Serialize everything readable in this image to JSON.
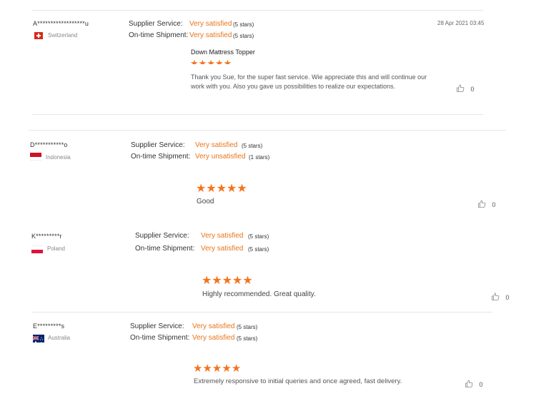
{
  "reviews": [
    {
      "buyer": "A******************u",
      "country": "Switzerland",
      "flag": "switzerland-flag",
      "supplier_label": "Supplier Service:",
      "supplier_value": "Very satisfied",
      "supplier_stars": "(5 stars)",
      "shipment_label": "On-time Shipment:",
      "shipment_value": "Very satisfied",
      "shipment_stars": "(5 stars)",
      "date": "28 Apr 2021 03:45",
      "product": "Down Mattress Topper",
      "rating": 5,
      "comment": "Thank you Sue, for the super fast service. Wie appreciate this and will continue our work with you. Also you gave us possibilities to realize our expectations.",
      "likes": "0"
    },
    {
      "buyer": "D***********o",
      "country": "Indonesia",
      "flag": "indonesia-flag",
      "supplier_label": "Supplier Service:",
      "supplier_value": "Very satisfied",
      "supplier_stars": "(5 stars)",
      "shipment_label": "On-time Shipment:",
      "shipment_value": "Very unsatisfied",
      "shipment_stars": "(1 stars)",
      "rating": 5,
      "comment": "Good",
      "likes": "0"
    },
    {
      "buyer": "K*********r",
      "country": "Poland",
      "flag": "poland-flag",
      "supplier_label": "Supplier Service:",
      "supplier_value": "Very satisfied",
      "supplier_stars": "(5 stars)",
      "shipment_label": "On-time Shipment:",
      "shipment_value": "Very satisfied",
      "shipment_stars": "(5 stars)",
      "rating": 5,
      "comment": "Highly recommended. Great quality.",
      "likes": "0"
    },
    {
      "buyer": "E*********s",
      "country": "Australia",
      "flag": "australia-flag",
      "supplier_label": "Supplier Service:",
      "supplier_value": "Very satisfied",
      "supplier_stars": "(5 stars)",
      "shipment_label": "On-time Shipment:",
      "shipment_value": "Very satisfied",
      "shipment_stars": "(5 stars)",
      "rating": 5,
      "comment": "Extremely responsive to initial queries and once agreed, fast delivery.",
      "likes": "0"
    }
  ],
  "colors": {
    "accent": "#e8741a",
    "star": "#f5731f",
    "divider": "#e6e6e6"
  }
}
